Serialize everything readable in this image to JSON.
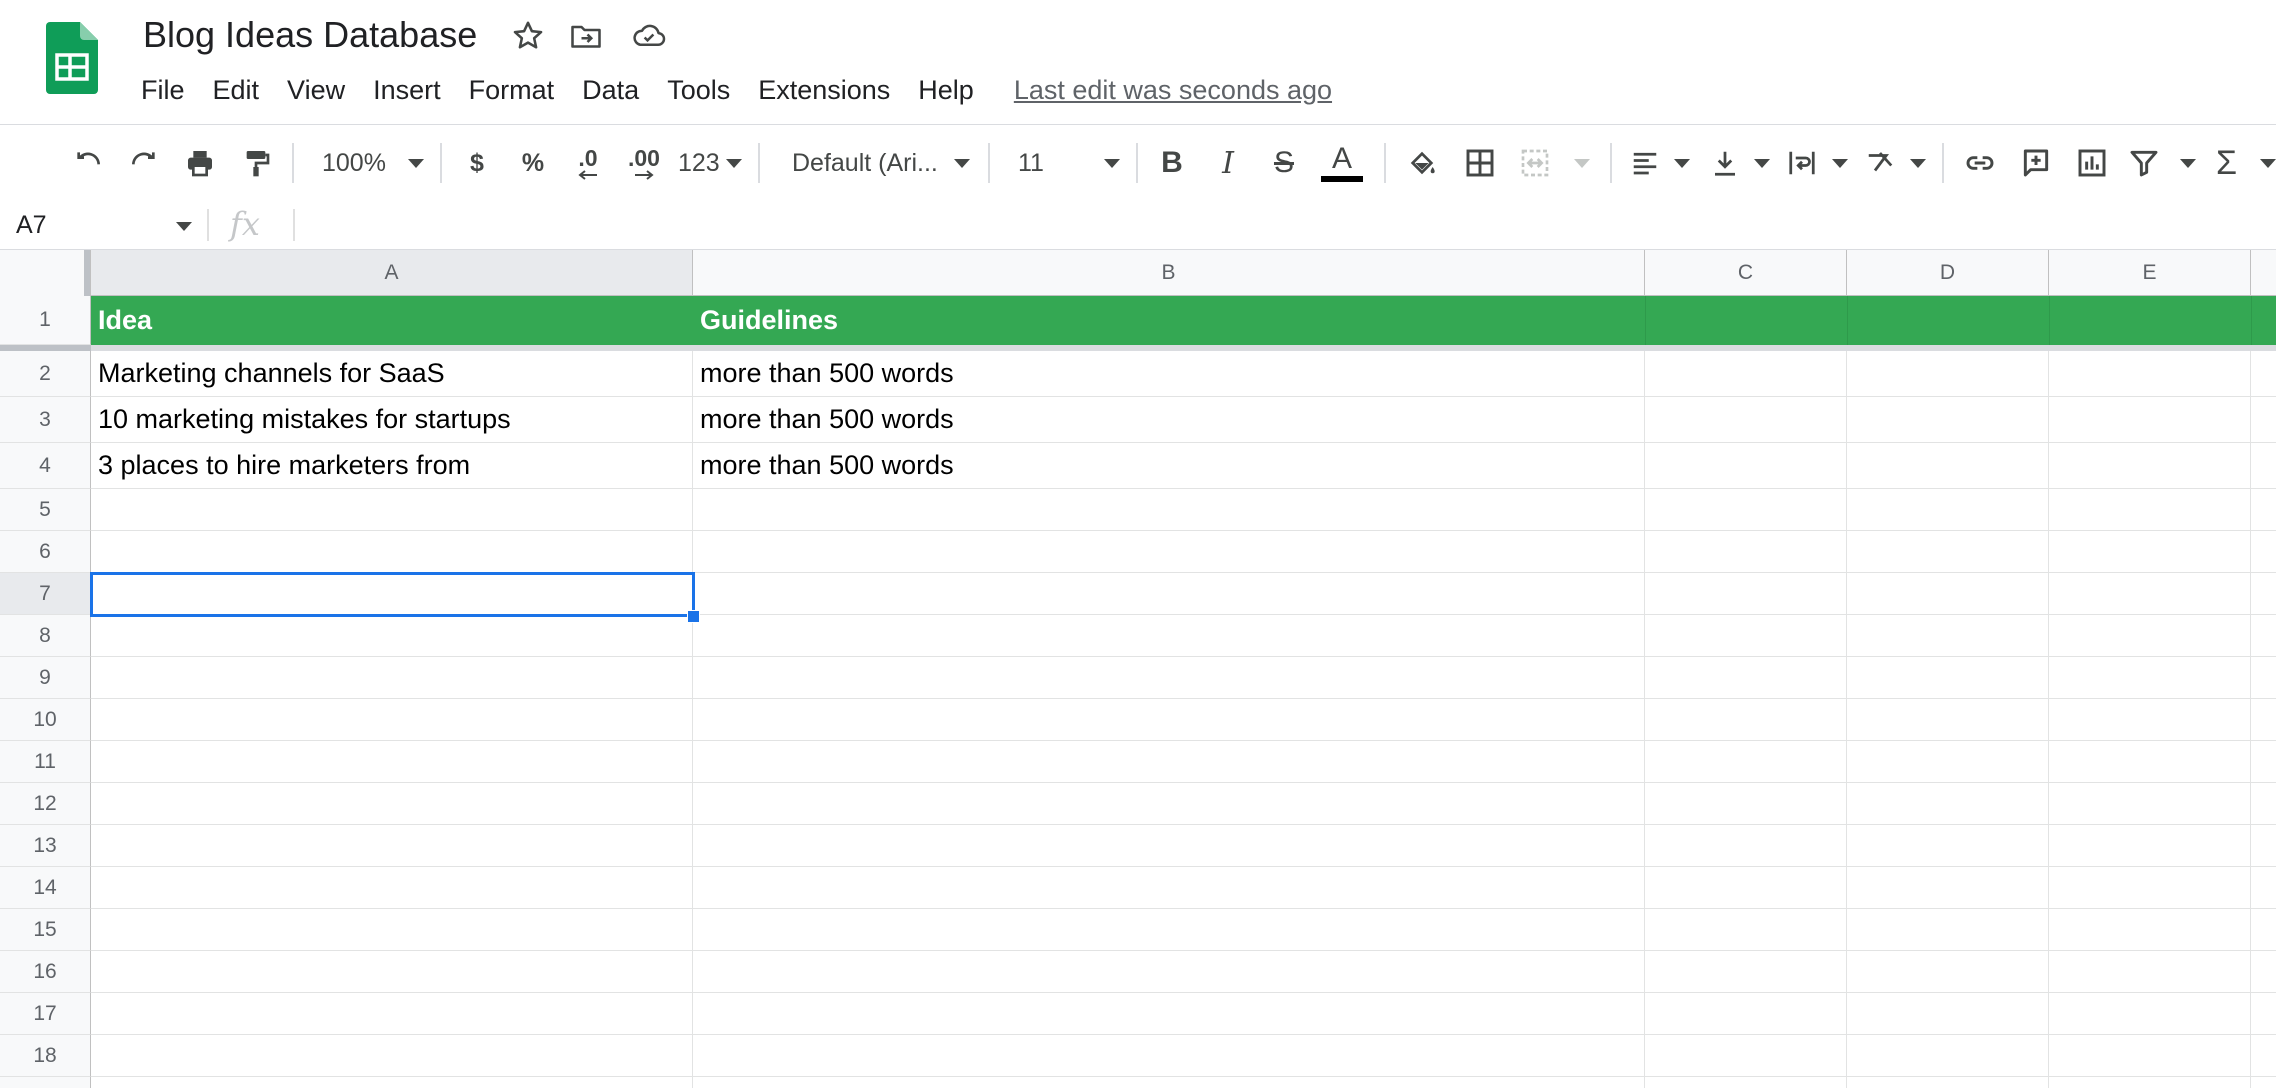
{
  "app": {
    "title": "Blog Ideas Database",
    "brand_color": "#0F9D58"
  },
  "title_icons": [
    "star-icon",
    "move-to-folder-icon",
    "cloud-saved-icon"
  ],
  "menu": {
    "items": [
      "File",
      "Edit",
      "View",
      "Insert",
      "Format",
      "Data",
      "Tools",
      "Extensions",
      "Help"
    ],
    "last_edit": "Last edit was seconds ago"
  },
  "toolbar": {
    "zoom": "100%",
    "currency": "$",
    "percent": "%",
    "decrease_decimal": ".0",
    "increase_decimal": ".00",
    "more_formats": "123",
    "font": "Default (Ari...",
    "font_size": "11",
    "bold": "B",
    "italic": "I",
    "strike": "S",
    "text_color_letter": "A",
    "text_color": "#000000",
    "sum": "Σ"
  },
  "formula_bar": {
    "name_box": "A7",
    "fx": "fx",
    "value": ""
  },
  "grid": {
    "columns": [
      "A",
      "B",
      "C",
      "D",
      "E"
    ],
    "rows": [
      "1",
      "2",
      "3",
      "4",
      "5",
      "6",
      "7",
      "8",
      "9",
      "10",
      "11",
      "12",
      "13",
      "14",
      "15",
      "16",
      "17",
      "18"
    ],
    "header_fill": "#34A853",
    "cells": {
      "A1": "Idea",
      "B1": "Guidelines",
      "A2": "Marketing channels for SaaS",
      "B2": "more than 500 words",
      "A3": "10 marketing mistakes for startups",
      "B3": "more than 500 words",
      "A4": "3 places to hire marketers from",
      "B4": "more than 500 words"
    },
    "selected_cell": "A7"
  }
}
